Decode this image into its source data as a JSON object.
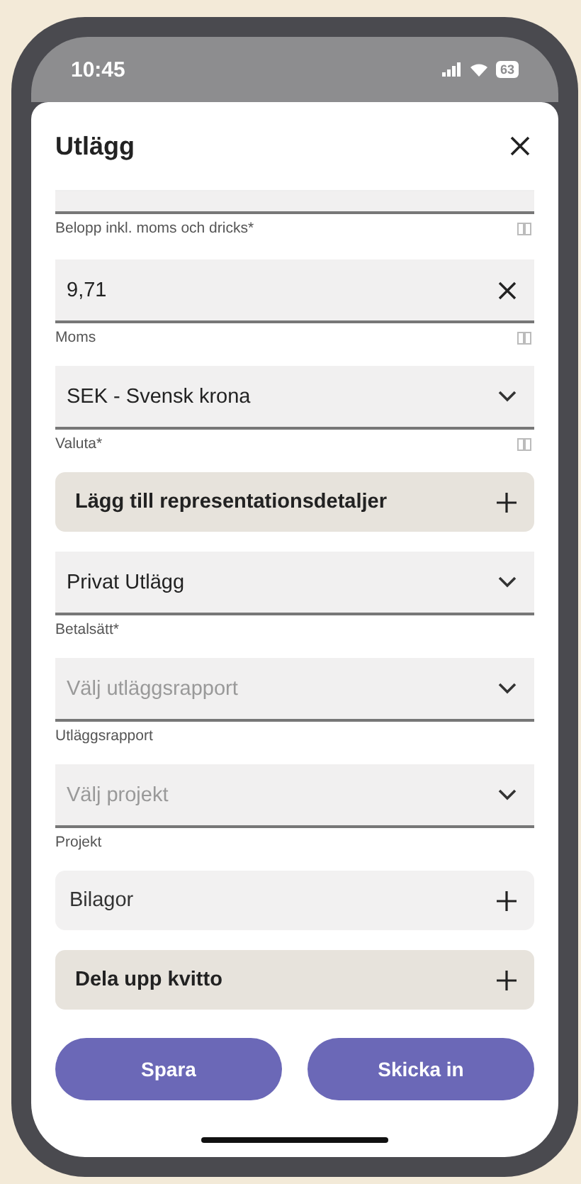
{
  "status_bar": {
    "time": "10:45",
    "battery": "63"
  },
  "sheet": {
    "title": "Utlägg"
  },
  "fields": [
    {
      "kind": "input",
      "label": "Belopp inkl. moms och dricks*",
      "help_icon": true,
      "partly_hidden": true
    },
    {
      "kind": "input",
      "value": "9,71",
      "label": "Moms",
      "help_icon": true
    },
    {
      "kind": "select",
      "value": "SEK - Svensk krona",
      "label": "Valuta*",
      "help_icon": true
    },
    {
      "kind": "section-button",
      "text": "Lägg till representationsdetaljer"
    },
    {
      "kind": "select",
      "value": "Privat Utlägg",
      "label": "Betalsätt*",
      "help_icon": false
    },
    {
      "kind": "select",
      "placeholder": "Välj utläggsrapport",
      "label": "Utläggsrapport",
      "help_icon": false
    },
    {
      "kind": "select",
      "placeholder": "Välj projekt",
      "label": "Projekt",
      "help_icon": false
    },
    {
      "kind": "add-row",
      "text": "Bilagor"
    },
    {
      "kind": "section-button",
      "text": "Dela upp kvitto"
    }
  ],
  "buttons": [
    "Spara",
    "Skicka in"
  ]
}
